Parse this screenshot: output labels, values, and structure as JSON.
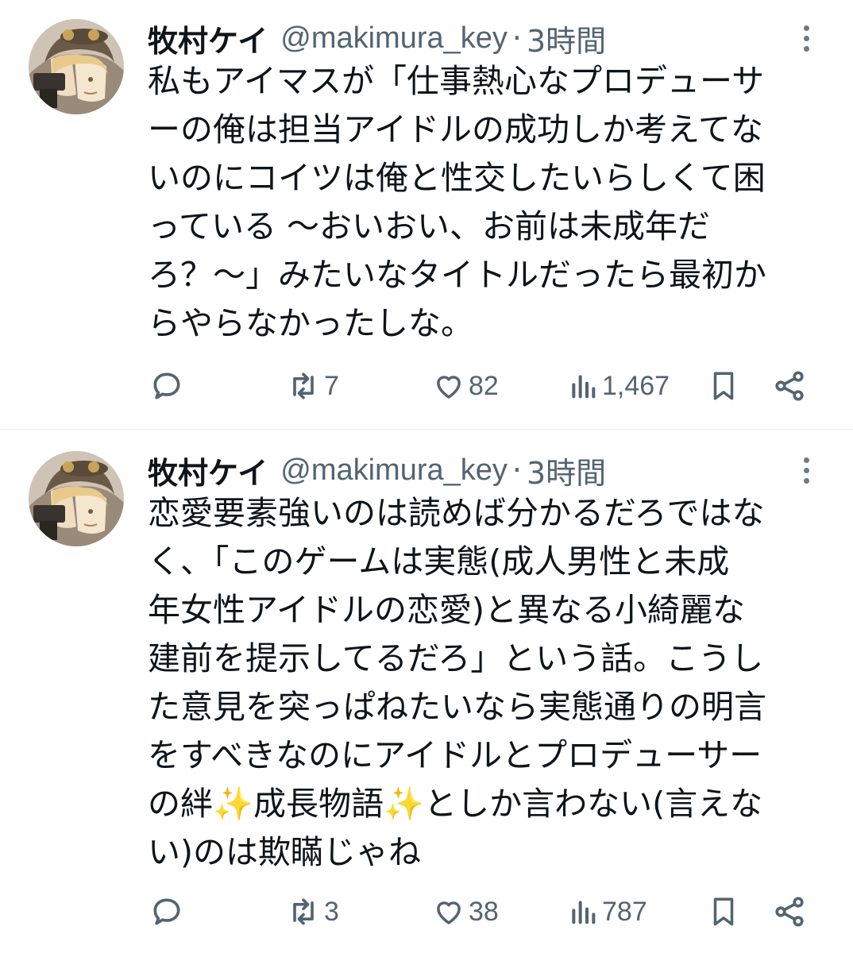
{
  "tweets": [
    {
      "author_name": "牧村ケイ",
      "handle": "@makimura_key",
      "separator": "·",
      "time": "3時間",
      "text_lines": [
        "私もアイマスが「仕事熱心なプロデューサ",
        "ーの俺は担当アイドルの成功しか考えてな",
        "いのにコイツは俺と性交したいらしくて困",
        "っている 〜おいおい、お前は未成年だ",
        "ろ？〜」みたいなタイトルだったら最初か",
        "らやらなかったしな。"
      ],
      "retweets": "7",
      "likes": "82",
      "views": "1,467"
    },
    {
      "author_name": "牧村ケイ",
      "handle": "@makimura_key",
      "separator": "·",
      "time": "3時間",
      "text_lines": [
        "恋愛要素強いのは読めば分かるだろではな",
        "く、「このゲームは実態(成人男性と未成",
        "年女性アイドルの恋愛)と異なる小綺麗な",
        "建前を提示してるだろ」という話。こうし",
        "た意見を突っぱねたいなら実態通りの明言",
        "をすべきなのにアイドルとプロデューサー",
        "の絆✨成長物語✨としか言わない(言えな",
        "い)のは欺瞞じゃね"
      ],
      "retweets": "3",
      "likes": "38",
      "views": "787"
    }
  ],
  "colors": {
    "text": "#0f1419",
    "secondary": "#536471",
    "divider": "#eff3f4"
  },
  "icons": [
    "reply-icon",
    "retweet-icon",
    "like-icon",
    "views-icon",
    "bookmark-icon",
    "share-icon",
    "more-icon"
  ]
}
